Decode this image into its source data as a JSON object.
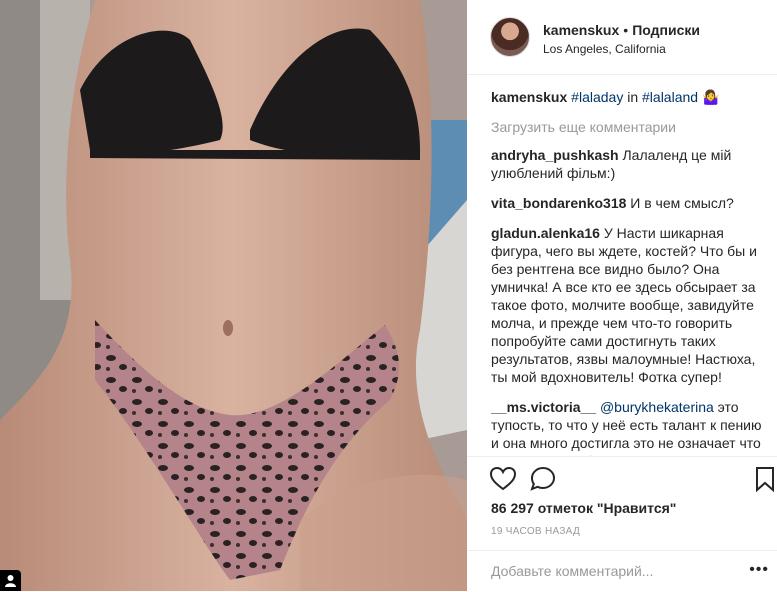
{
  "post": {
    "username": "kamenskux",
    "separator": "•",
    "follow_label": "Подписки",
    "location": "Los Angeles, California"
  },
  "caption": {
    "username": "kamenskux",
    "tag1": "#laladay",
    "middle": " in ",
    "tag2": "#lalaland",
    "emoji": "🤷‍♀️"
  },
  "load_more": "Загрузить еще комментарии",
  "comments": [
    {
      "user": "andryha_pushkash",
      "text": " Лалаленд це мій улюблений фільм:)"
    },
    {
      "user": "vita_bondarenko318",
      "text": " И в чем смысл?"
    },
    {
      "user": "gladun.alenka16",
      "text": " У Насти шикарная фигура, чего вы ждете, костей? Что бы и без рентгена все видно было? Она умничка! А все кто ее здесь обсырает за такое фото, молчите вообще, завидуйте молча, и прежде чем что-то говорить попробуйте сами достигнуть таких результатов, язвы малоумные! Настюха, ты мой вдохновитель! Фотка супер!"
    },
    {
      "user": "__ms.victoria__",
      "mention": "@burykhekaterina",
      "text": " это тупость, то что у неё есть талант к пению и она много достигла это не означает что у неё должны быть фотки исключительно такого плана. Пусть"
    }
  ],
  "likes": "86 297 отметок \"Нравится\"",
  "time": "19 ЧАСОВ НАЗАД",
  "add_comment_placeholder": "Добавьте комментарий...",
  "more_dots": "•••",
  "icons": [
    "heart-icon",
    "comment-icon",
    "bookmark-icon",
    "user-tag-icon",
    "more-options-icon"
  ]
}
